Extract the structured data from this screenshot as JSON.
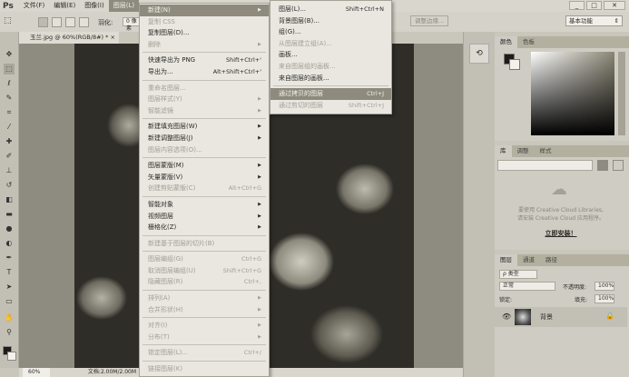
{
  "app": {
    "logo": "Ps",
    "menus": [
      "文件(F)",
      "编辑(E)",
      "图像(I)",
      "图层(L)"
    ],
    "active_menu": "图层(L)"
  },
  "window": {
    "minimize": "_",
    "maximize": "□",
    "close": "✕"
  },
  "options": {
    "feather_label": "羽化:",
    "feather_value": "0 像素",
    "refine_edge": "调整边缘...",
    "workspace": "基本功能"
  },
  "document": {
    "tab": "玉兰.jpg @ 60%(RGB/8#) *",
    "tab_close": "×",
    "zoom": "60%",
    "doc_info": "文档:2.00M/2.00M"
  },
  "layer_menu": [
    {
      "label": "新建(N)",
      "arrow": true,
      "state": "hi"
    },
    {
      "label": "复制 CSS",
      "state": "dis"
    },
    {
      "label": "复制图层(D)..."
    },
    {
      "label": "删除",
      "arrow": true,
      "state": "dis"
    },
    {
      "sep": true
    },
    {
      "label": "快速导出为 PNG",
      "shortcut": "Shift+Ctrl+'"
    },
    {
      "label": "导出为...",
      "shortcut": "Alt+Shift+Ctrl+'"
    },
    {
      "sep": true
    },
    {
      "label": "重命名图层...",
      "state": "dis"
    },
    {
      "label": "图层样式(Y)",
      "arrow": true,
      "state": "dis"
    },
    {
      "label": "智能滤镜",
      "arrow": true,
      "state": "dis"
    },
    {
      "sep": true
    },
    {
      "label": "新建填充图层(W)",
      "arrow": true
    },
    {
      "label": "新建调整图层(J)",
      "arrow": true
    },
    {
      "label": "图层内容选项(O)...",
      "state": "dis"
    },
    {
      "sep": true
    },
    {
      "label": "图层蒙版(M)",
      "arrow": true
    },
    {
      "label": "矢量蒙版(V)",
      "arrow": true
    },
    {
      "label": "创建剪贴蒙版(C)",
      "shortcut": "Alt+Ctrl+G",
      "state": "dis"
    },
    {
      "sep": true
    },
    {
      "label": "智能对象",
      "arrow": true
    },
    {
      "label": "视频图层",
      "arrow": true
    },
    {
      "label": "栅格化(Z)",
      "arrow": true
    },
    {
      "sep": true
    },
    {
      "label": "新建基于图层的切片(B)",
      "state": "dis"
    },
    {
      "sep": true
    },
    {
      "label": "图层编组(G)",
      "shortcut": "Ctrl+G",
      "state": "dis"
    },
    {
      "label": "取消图层编组(U)",
      "shortcut": "Shift+Ctrl+G",
      "state": "dis"
    },
    {
      "label": "隐藏图层(R)",
      "shortcut": "Ctrl+,",
      "state": "dis"
    },
    {
      "sep": true
    },
    {
      "label": "排列(A)",
      "arrow": true,
      "state": "dis"
    },
    {
      "label": "合并形状(H)",
      "arrow": true,
      "state": "dis"
    },
    {
      "sep": true
    },
    {
      "label": "对齐(I)",
      "arrow": true,
      "state": "dis"
    },
    {
      "label": "分布(T)",
      "arrow": true,
      "state": "dis"
    },
    {
      "sep": true
    },
    {
      "label": "锁定图层(L)...",
      "shortcut": "Ctrl+/",
      "state": "dis"
    },
    {
      "sep": true
    },
    {
      "label": "链接图层(K)",
      "state": "dis"
    }
  ],
  "new_submenu": [
    {
      "label": "图层(L)...",
      "shortcut": "Shift+Ctrl+N"
    },
    {
      "label": "背景图层(B)..."
    },
    {
      "label": "组(G)..."
    },
    {
      "label": "从图层建立组(A)...",
      "state": "dis"
    },
    {
      "label": "画板..."
    },
    {
      "label": "来自图层组的画板...",
      "state": "dis"
    },
    {
      "label": "来自图层的画板..."
    },
    {
      "sep": true
    },
    {
      "label": "通过拷贝的图层",
      "shortcut": "Ctrl+J",
      "state": "hi"
    },
    {
      "label": "通过剪切的图层",
      "shortcut": "Shift+Ctrl+J",
      "state": "dis"
    }
  ],
  "color_panel": {
    "tabs": [
      "颜色",
      "色板"
    ]
  },
  "libraries_panel": {
    "tabs": [
      "库",
      "调整",
      "样式"
    ],
    "message1": "要使用 Creative Cloud Libraries,",
    "message2": "请安装 Creative Cloud 应用程序。",
    "link": "立即安装！"
  },
  "layers_panel": {
    "tabs": [
      "图层",
      "通道",
      "路径"
    ],
    "filter": "ρ 类型",
    "blend_mode": "正常",
    "opacity_label": "不透明度:",
    "opacity": "100%",
    "lock_label": "锁定:",
    "fill_label": "填充:",
    "fill": "100%",
    "layers": [
      {
        "name": "背景",
        "visible": true,
        "locked": true
      }
    ]
  }
}
